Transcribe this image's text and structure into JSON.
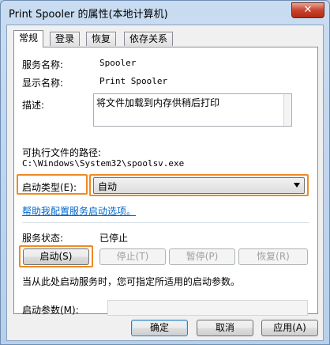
{
  "window": {
    "title": "Print Spooler 的属性(本地计算机)",
    "close_glyph": "✕"
  },
  "tabs": [
    {
      "label": "常规",
      "active": true
    },
    {
      "label": "登录",
      "active": false
    },
    {
      "label": "恢复",
      "active": false
    },
    {
      "label": "依存关系",
      "active": false
    }
  ],
  "general": {
    "service_name_label": "服务名称:",
    "service_name_value": "Spooler",
    "display_name_label": "显示名称:",
    "display_name_value": "Print Spooler",
    "description_label": "描述:",
    "description_value": "将文件加载到内存供稍后打印",
    "exe_path_label": "可执行文件的路径:",
    "exe_path_value": "C:\\Windows\\System32\\spoolsv.exe",
    "startup_type_label": "启动类型(E):",
    "startup_type_value": "自动",
    "help_link": "帮助我配置服务启动选项。",
    "service_status_label": "服务状态:",
    "service_status_value": "已停止",
    "start_button": "启动(S)",
    "stop_button": "停止(T)",
    "pause_button": "暂停(P)",
    "resume_button": "恢复(R)",
    "hint_text": "当从此处启动服务时，您可指定所适用的启动参数。",
    "start_params_label": "启动参数(M):",
    "start_params_value": ""
  },
  "footer": {
    "ok_button": "确定",
    "cancel_button": "取消",
    "apply_button": "应用(A)"
  },
  "colors": {
    "highlight": "#f08a24",
    "link": "#0066cc"
  }
}
